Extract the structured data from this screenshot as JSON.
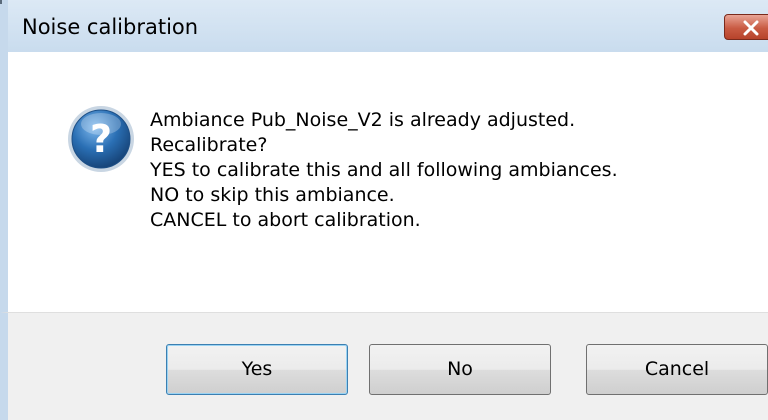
{
  "window": {
    "title": "Noise calibration"
  },
  "message": {
    "lines": [
      "Ambiance Pub_Noise_V2 is already adjusted.",
      "Recalibrate?",
      "YES to calibrate this and all following ambiances.",
      "NO to skip this ambiance.",
      "CANCEL to abort calibration."
    ],
    "icon": "question-icon"
  },
  "buttons": {
    "yes": "Yes",
    "no": "No",
    "cancel": "Cancel"
  },
  "colors": {
    "titlebar": "#c9dcee",
    "close_button": "#c95b43",
    "footer": "#f0f0f0",
    "icon_blue": "#2a6fb4"
  }
}
